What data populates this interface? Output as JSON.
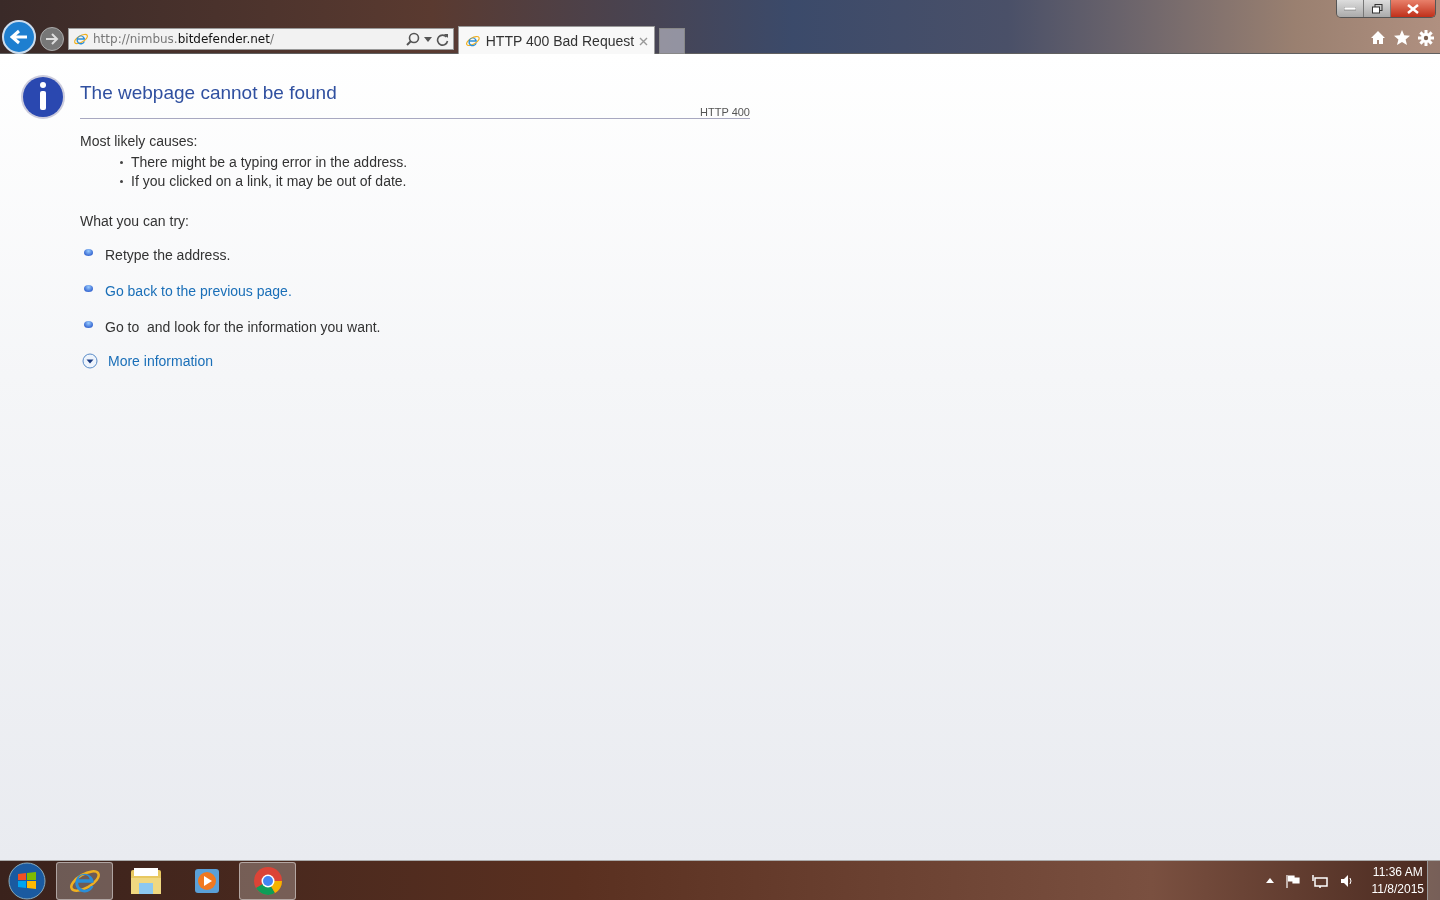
{
  "browser": {
    "address": "http://nimbus.**bitdefender.net**/",
    "tabs": [
      {
        "title": "HTTP 400 Bad Request",
        "selected": true
      }
    ]
  },
  "page": {
    "title": "The webpage cannot be found",
    "code": "HTTP 400",
    "causes_heading": "Most likely causes:",
    "causes": [
      "There might be a typing error in the address.",
      "If you clicked on a link, it may be out of date."
    ],
    "try_heading": "What you can try:",
    "actions": [
      {
        "text": "Retype the address.",
        "kind": "text"
      },
      {
        "text": "Go back to the previous page.",
        "kind": "link"
      },
      {
        "text": "Go to  and look for the information you want.",
        "kind": "text"
      }
    ],
    "more": "More information"
  },
  "taskbar": {
    "apps": [
      {
        "kind": "ie",
        "selected": true
      },
      {
        "kind": "folder",
        "selected": false
      },
      {
        "kind": "media",
        "selected": false
      },
      {
        "kind": "chrome",
        "selected": true
      }
    ],
    "time": "11:36 AM",
    "date": "11/8/2015"
  }
}
